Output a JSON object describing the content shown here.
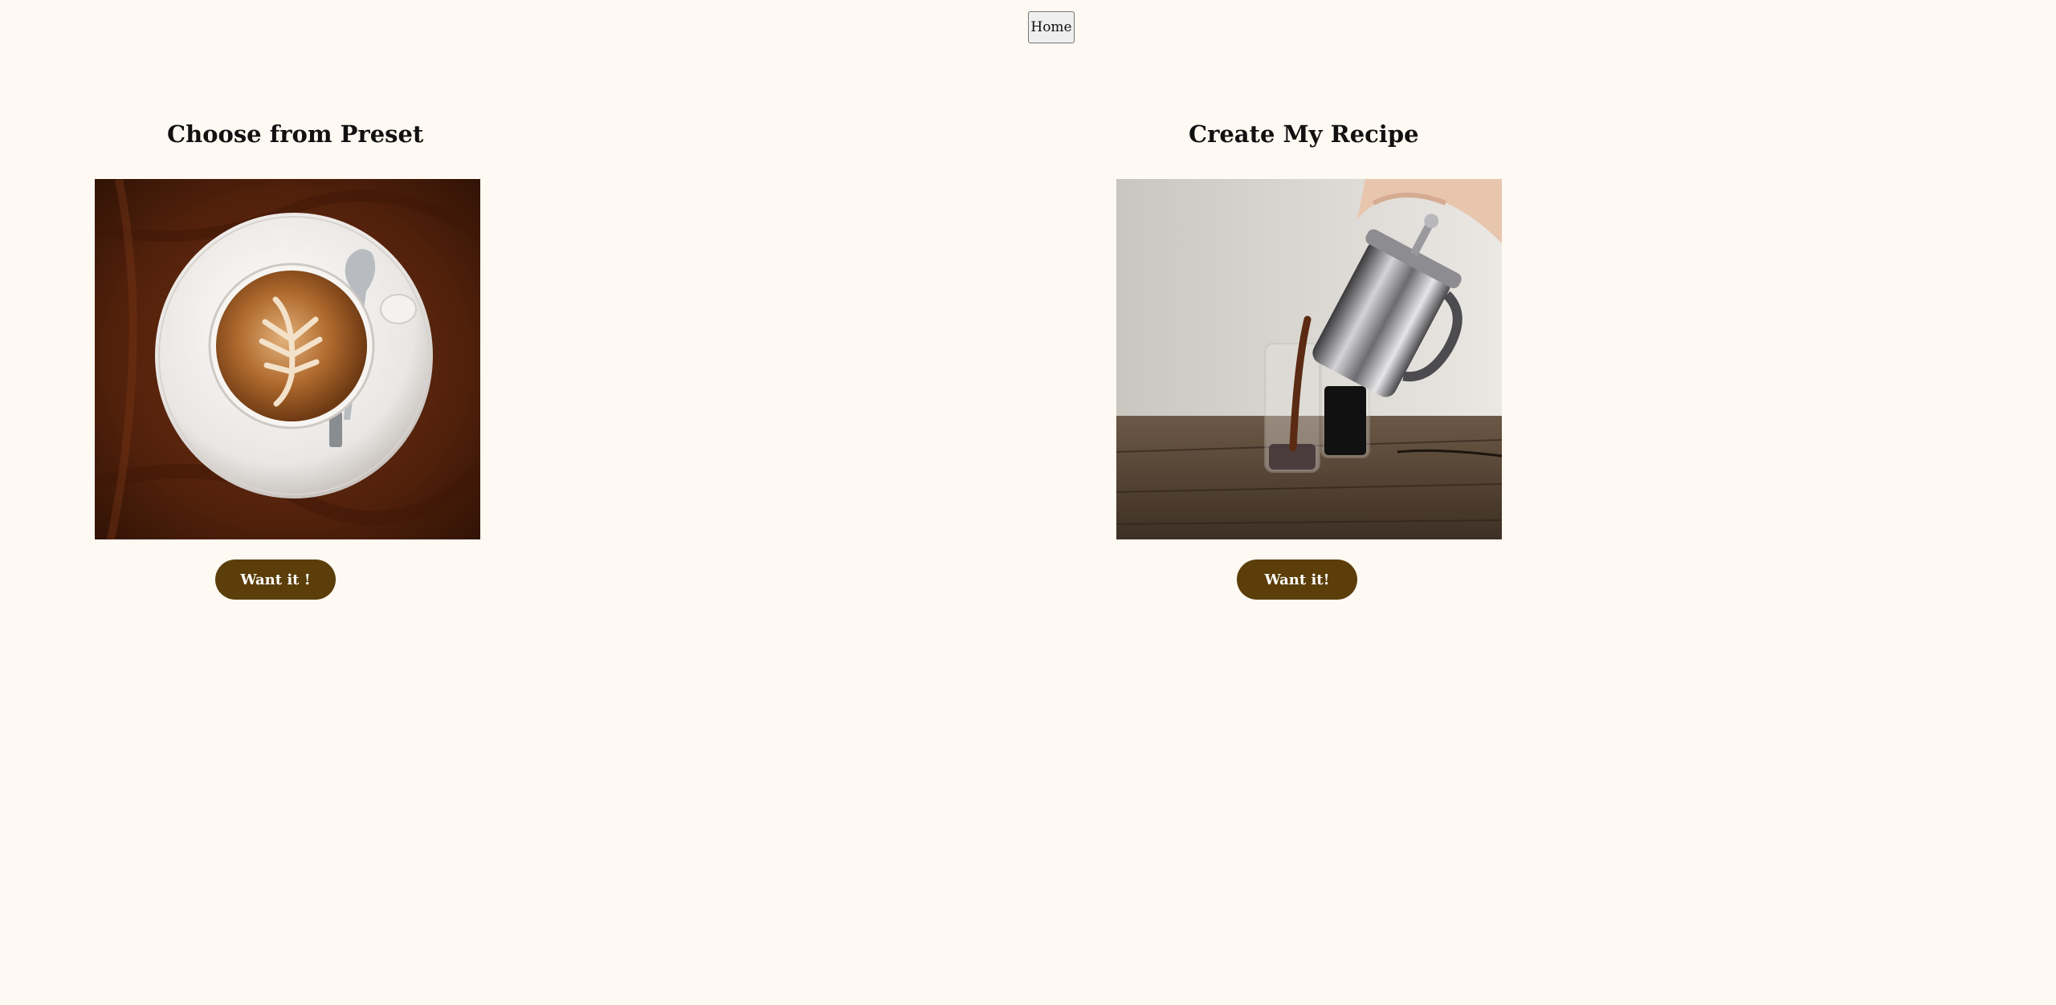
{
  "nav": {
    "home_label": "Home"
  },
  "options": {
    "preset": {
      "title": "Choose from Preset",
      "image_subject": "latte-art-cup-on-saucer",
      "button_label": "Want it !"
    },
    "recipe": {
      "title": "Create My Recipe",
      "image_subject": "french-press-pouring-coffee",
      "button_label": "Want it!"
    }
  },
  "colors": {
    "background": "#fef9f2",
    "button_brown": "#5b3e09",
    "button_text": "#ffffff"
  }
}
